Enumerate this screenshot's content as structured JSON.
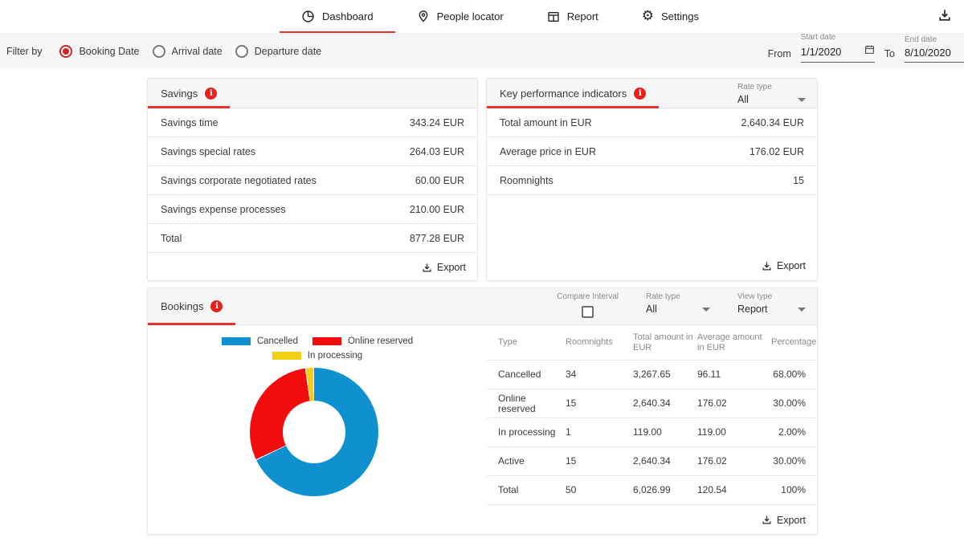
{
  "nav": {
    "tabs": [
      {
        "label": "Dashboard",
        "active": true
      },
      {
        "label": "People locator",
        "active": false
      },
      {
        "label": "Report",
        "active": false
      },
      {
        "label": "Settings",
        "active": false
      }
    ]
  },
  "filter": {
    "label": "Filter by",
    "options": [
      {
        "label": "Booking Date",
        "selected": true
      },
      {
        "label": "Arrival date",
        "selected": false
      },
      {
        "label": "Departure date",
        "selected": false
      }
    ],
    "from_label": "From",
    "to_label": "To",
    "start_date": {
      "label": "Start date",
      "value": "1/1/2020"
    },
    "end_date": {
      "label": "End date",
      "value": "8/10/2020"
    }
  },
  "savings": {
    "title": "Savings",
    "rows": [
      {
        "label": "Savings time",
        "value": "343.24 EUR"
      },
      {
        "label": "Savings special rates",
        "value": "264.03 EUR"
      },
      {
        "label": "Savings corporate negotiated rates",
        "value": "60.00 EUR"
      },
      {
        "label": "Savings expense processes",
        "value": "210.00 EUR"
      },
      {
        "label": "Total",
        "value": "877.28 EUR"
      }
    ],
    "export_label": "Export"
  },
  "kpi": {
    "title": "Key performance indicators",
    "rate_type": {
      "label": "Rate type",
      "value": "All"
    },
    "rows": [
      {
        "label": "Total amount in EUR",
        "value": "2,640.34 EUR"
      },
      {
        "label": "Average price in EUR",
        "value": "176.02 EUR"
      },
      {
        "label": "Roomnights",
        "value": "15"
      }
    ],
    "export_label": "Export"
  },
  "bookings": {
    "title": "Bookings",
    "compare_interval_label": "Compare Interval",
    "rate_type": {
      "label": "Rate type",
      "value": "All"
    },
    "view_type": {
      "label": "View type",
      "value": "Report"
    },
    "table": {
      "headers": [
        "Type",
        "Roomnights",
        "Total amount in EUR",
        "Average amount in EUR",
        "Percentage"
      ],
      "rows": [
        [
          "Cancelled",
          "34",
          "3,267.65",
          "96.11",
          "68.00%"
        ],
        [
          "Online reserved",
          "15",
          "2,640.34",
          "176.02",
          "30.00%"
        ],
        [
          "In processing",
          "1",
          "119.00",
          "119.00",
          "2.00%"
        ],
        [
          "Active",
          "15",
          "2,640.34",
          "176.02",
          "30.00%"
        ],
        [
          "Total",
          "50",
          "6,026.99",
          "120.54",
          "100%"
        ]
      ]
    },
    "export_label": "Export"
  },
  "chart_data": {
    "type": "pie",
    "donut": true,
    "labels": [
      "Cancelled",
      "Online reserved",
      "In processing"
    ],
    "values": [
      68,
      30,
      2
    ],
    "colors": [
      "#0f90cf",
      "#f20d0d",
      "#f0d116"
    ],
    "legend_position": "top"
  },
  "colors": {
    "accent_red": "#e5342c",
    "info_badge": "#e5231c",
    "header_bg": "#f6f6f6",
    "filter_bar_bg": "#f7f7f7"
  }
}
